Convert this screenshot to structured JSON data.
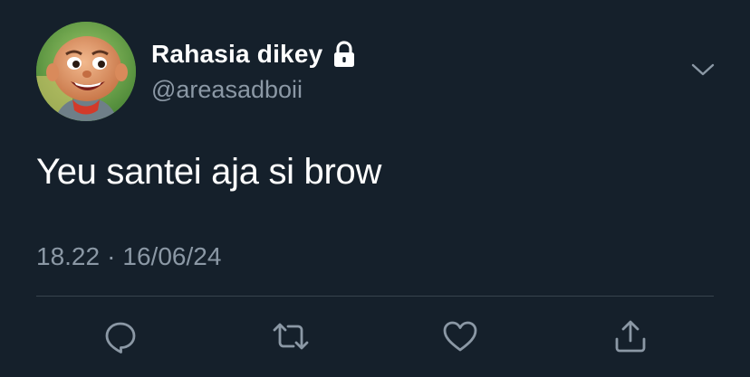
{
  "user": {
    "display_name": "Rahasia dikey",
    "handle": "@areasadboii",
    "protected_icon": "lock-icon",
    "avatar": "cartoon-boy-avatar"
  },
  "tweet": {
    "text": "Yeu santei aja si brow",
    "time": "18.22",
    "separator": "·",
    "date": "16/06/24"
  },
  "actions": [
    {
      "icon": "reply-icon"
    },
    {
      "icon": "retweet-icon"
    },
    {
      "icon": "like-icon"
    },
    {
      "icon": "share-icon"
    }
  ],
  "colors": {
    "background": "#15202b",
    "text_primary": "#ffffff",
    "text_secondary": "#8b98a5",
    "divider": "#38444d"
  }
}
